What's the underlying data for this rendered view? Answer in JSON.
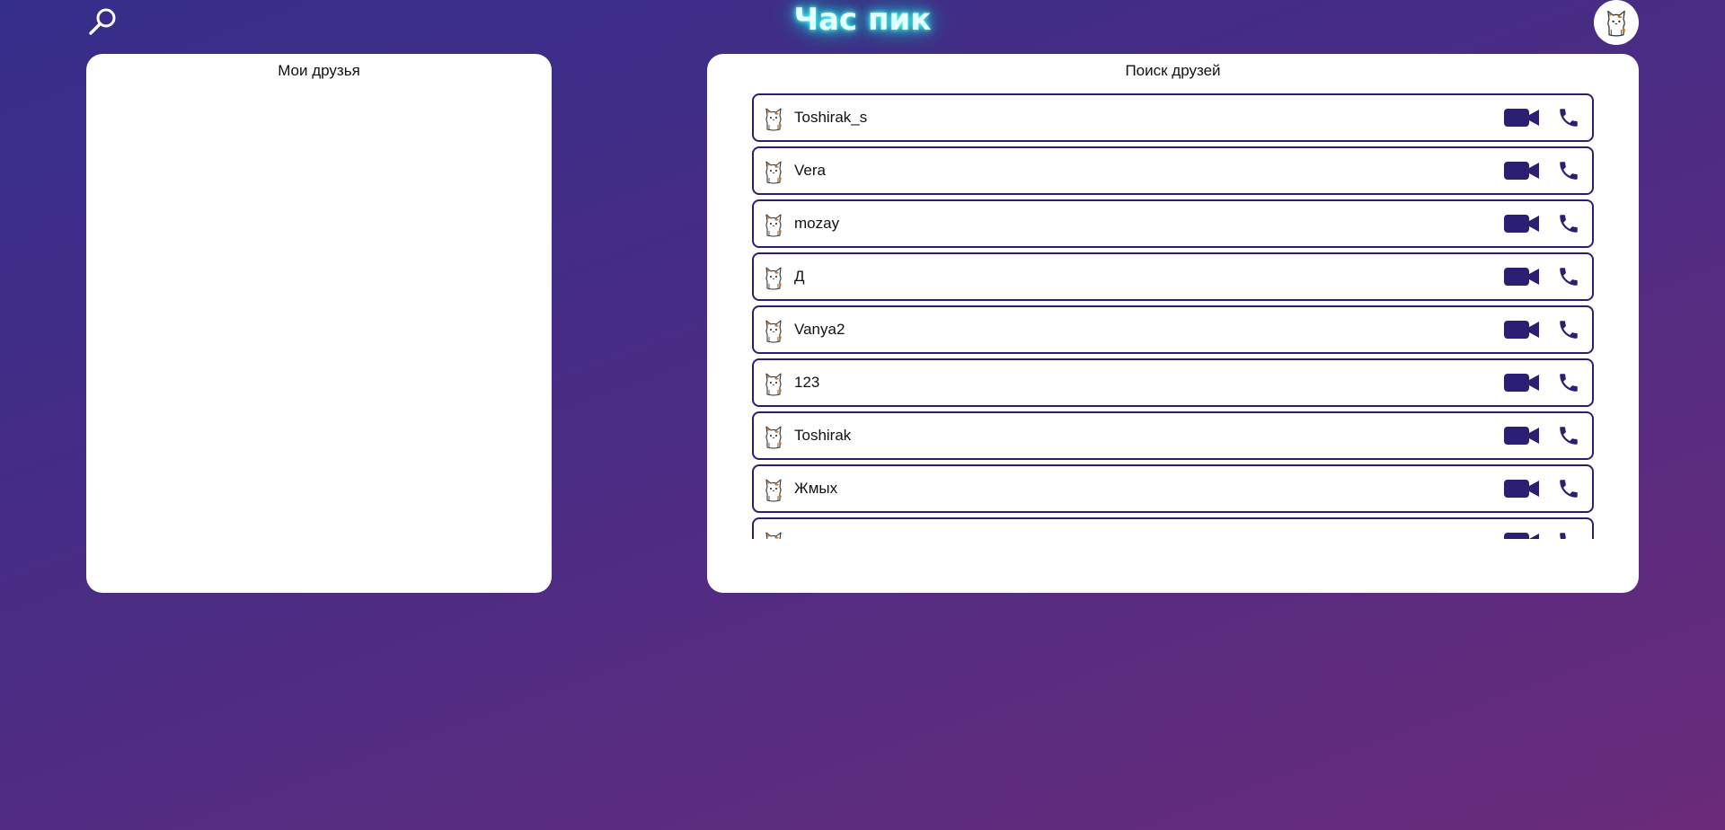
{
  "header": {
    "title": "Час пик",
    "search_icon": "search-icon",
    "profile_avatar_icon": "cat-avatar-icon"
  },
  "friends_panel": {
    "title": "Мои друзья",
    "items": []
  },
  "search_panel": {
    "title": "Поиск друзей",
    "results": [
      {
        "name": "Toshirak_s"
      },
      {
        "name": "Vera"
      },
      {
        "name": "mozay"
      },
      {
        "name": "Д"
      },
      {
        "name": "Vanya2"
      },
      {
        "name": "123"
      },
      {
        "name": "Toshirak"
      },
      {
        "name": "Жмых"
      },
      {
        "name": ""
      }
    ],
    "row_icons": {
      "avatar": "cat-avatar-icon",
      "video": "video-camera-icon",
      "call": "phone-icon"
    }
  },
  "colors": {
    "accent": "#2b1f73",
    "title_glow": "#33e6e6",
    "background_start": "#352e8a",
    "background_end": "#6a2b7a"
  }
}
